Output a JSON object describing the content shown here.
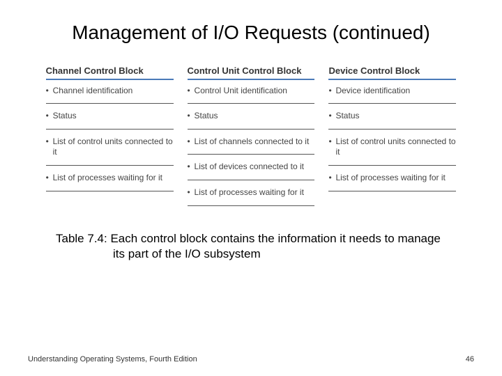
{
  "title": "Management of I/O Requests (continued)",
  "columns": [
    {
      "header": "Channel Control Block",
      "items": [
        "Channel identification",
        "Status",
        "List of control units connected to it",
        "List of processes waiting for it"
      ]
    },
    {
      "header": "Control Unit Control Block",
      "items": [
        "Control Unit identification",
        "Status",
        "List of channels connected to it",
        "List of devices connected to it",
        "List of processes waiting for it"
      ]
    },
    {
      "header": "Device Control Block",
      "items": [
        "Device identification",
        "Status",
        "List of control units connected to it",
        "List of processes waiting for it"
      ]
    }
  ],
  "caption": "Table 7.4: Each control block contains the information it needs to manage its part of the I/O subsystem",
  "footer_left": "Understanding Operating Systems, Fourth Edition",
  "footer_right": "46"
}
